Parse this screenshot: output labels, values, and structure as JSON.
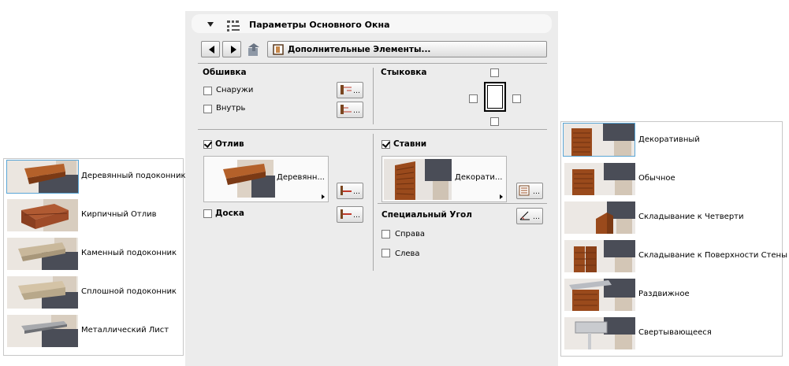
{
  "header": {
    "title": "Параметры Основного Окна"
  },
  "toolbar": {
    "extra_button_label": "Дополнительные Элементы..."
  },
  "trim": {
    "section_label": "Обшивка",
    "outside_label": "Снаружи",
    "inside_label": "Внутрь",
    "outside_checked": false,
    "inside_checked": false
  },
  "junction": {
    "section_label": "Стыковка"
  },
  "sill": {
    "label": "Отлив",
    "checked": true,
    "picker_value": "Деревянн...",
    "board_label": "Доска",
    "board_checked": false
  },
  "shutters": {
    "label": "Ставни",
    "checked": true,
    "picker_value": "Декорати...",
    "special_corner_label": "Специальный Угол",
    "right_label": "Справа",
    "left_label": "Слева"
  },
  "sill_list": [
    {
      "label": "Деревянный подоконник",
      "icon": "wood-sill-thumbnail",
      "selected": true
    },
    {
      "label": "Кирпичный Отлив",
      "icon": "brick-sill-thumbnail",
      "selected": false
    },
    {
      "label": "Каменный подоконник",
      "icon": "stone-sill-thumbnail",
      "selected": false
    },
    {
      "label": "Сплошной подоконник",
      "icon": "solid-sill-thumbnail",
      "selected": false
    },
    {
      "label": "Металлический Лист",
      "icon": "metal-sheet-thumbnail",
      "selected": false
    }
  ],
  "shutter_list": [
    {
      "label": "Декоративный",
      "icon": "decorative-shutter-thumbnail",
      "selected": true
    },
    {
      "label": "Обычное",
      "icon": "regular-shutter-thumbnail",
      "selected": false
    },
    {
      "label": "Складывание к Четверти",
      "icon": "fold-to-quarter-thumbnail",
      "selected": false
    },
    {
      "label": "Складывание к Поверхности Стены",
      "icon": "fold-to-wall-thumbnail",
      "selected": false
    },
    {
      "label": "Раздвижное",
      "icon": "sliding-shutter-thumbnail",
      "selected": false
    },
    {
      "label": "Свертывающееся",
      "icon": "rolling-shutter-thumbnail",
      "selected": false
    }
  ],
  "colors": {
    "panel_bg": "#ececec",
    "wall_dark": "#4a4d57",
    "wood": "#9a4a1c",
    "selection": "#5aa6d6"
  }
}
